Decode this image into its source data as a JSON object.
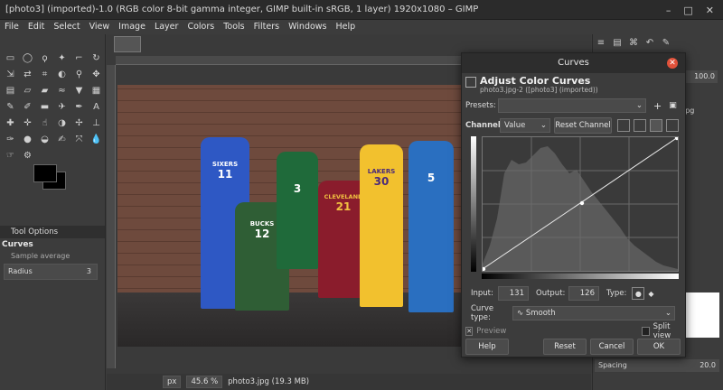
{
  "window": {
    "title": "[photo3] (imported)-1.0 (RGB color 8-bit gamma integer, GIMP built-in sRGB, 1 layer) 1920x1080 – GIMP"
  },
  "menu": [
    "File",
    "Edit",
    "Select",
    "View",
    "Image",
    "Layer",
    "Colors",
    "Tools",
    "Filters",
    "Windows",
    "Help"
  ],
  "toolbox": {
    "tool_options_tab": "Tool Options",
    "tool_name": "Curves",
    "sample_average": "Sample average",
    "radius_label": "Radius",
    "radius_value": "3"
  },
  "status": {
    "unit": "px",
    "zoom": "45.6 %",
    "file_info": "photo3.jpg (19.3 MB)"
  },
  "dock": {
    "opacity_value": "100.0",
    "layer_name_fragment": "jpg",
    "spacing_label": "Spacing",
    "spacing_value": "20.0"
  },
  "dialog": {
    "title": "Curves",
    "heading": "Adjust Color Curves",
    "subheading": "photo3.jpg-2 ([photo3] (imported))",
    "presets_label": "Presets:",
    "channel_label": "Channel:",
    "channel_value": "Value",
    "reset_channel": "Reset Channel",
    "input_label": "Input:",
    "input_value": "131",
    "output_label": "Output:",
    "output_value": "126",
    "type_label": "Type:",
    "curve_type_label": "Curve type:",
    "curve_type_value": "Smooth",
    "preview_label": "Preview",
    "split_view_label": "Split view",
    "buttons": {
      "help": "Help",
      "reset": "Reset",
      "cancel": "Cancel",
      "ok": "OK"
    }
  },
  "jerseys": {
    "p1_team": "SIXERS",
    "p1_num": "11",
    "p2_team": "BUCKS",
    "p2_num": "12",
    "p3_num": "3",
    "p4_team": "CLEVELAND",
    "p4_num": "21",
    "p5_team": "LAKERS",
    "p5_num": "30",
    "p6_num": "5"
  }
}
